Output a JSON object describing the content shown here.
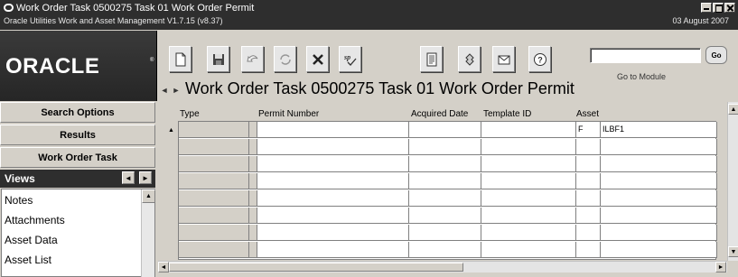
{
  "window": {
    "title": "Work Order Task 0500275 Task 01 Work Order Permit",
    "subtitle": "Oracle Utilities Work and Asset Management V1.7.15 (v8.37)",
    "date": "03 August  2007"
  },
  "logo": {
    "text": "ORACLE",
    "mark": "®"
  },
  "toolbar": {
    "buttons": [
      {
        "name": "new-document-icon"
      },
      {
        "name": "save-icon"
      },
      {
        "name": "undo-icon"
      },
      {
        "name": "refresh-icon"
      },
      {
        "name": "delete-icon"
      },
      {
        "name": "spell-check-icon",
        "text": "sp"
      },
      {
        "name": "report-icon"
      },
      {
        "name": "approval-icon"
      },
      {
        "name": "email-icon"
      },
      {
        "name": "help-icon"
      }
    ],
    "goto_label": "Go to Module",
    "goto_button": "Go",
    "goto_value": ""
  },
  "page_title": "Work Order Task 0500275 Task 01 Work Order Permit",
  "nav_arrows": {
    "back": "◄",
    "forward": "►"
  },
  "sidebar": {
    "buttons": [
      "Search Options",
      "Results",
      "Work Order Task"
    ],
    "views_label": "Views",
    "views_items": [
      "Notes",
      "Attachments",
      "Asset Data",
      "Asset List"
    ]
  },
  "grid": {
    "columns": [
      "Type",
      "Permit Number",
      "Acquired Date",
      "Template ID",
      "Asset"
    ],
    "rows": [
      {
        "type": "",
        "permit": "",
        "acquired": "",
        "template": "",
        "asset_flag": "F",
        "asset": "ILBF1"
      },
      {
        "type": "",
        "permit": "",
        "acquired": "",
        "template": "",
        "asset_flag": "",
        "asset": ""
      },
      {
        "type": "",
        "permit": "",
        "acquired": "",
        "template": "",
        "asset_flag": "",
        "asset": ""
      },
      {
        "type": "",
        "permit": "",
        "acquired": "",
        "template": "",
        "asset_flag": "",
        "asset": ""
      },
      {
        "type": "",
        "permit": "",
        "acquired": "",
        "template": "",
        "asset_flag": "",
        "asset": ""
      },
      {
        "type": "",
        "permit": "",
        "acquired": "",
        "template": "",
        "asset_flag": "",
        "asset": ""
      },
      {
        "type": "",
        "permit": "",
        "acquired": "",
        "template": "",
        "asset_flag": "",
        "asset": ""
      },
      {
        "type": "",
        "permit": "",
        "acquired": "",
        "template": "",
        "asset_flag": "",
        "asset": ""
      }
    ]
  }
}
